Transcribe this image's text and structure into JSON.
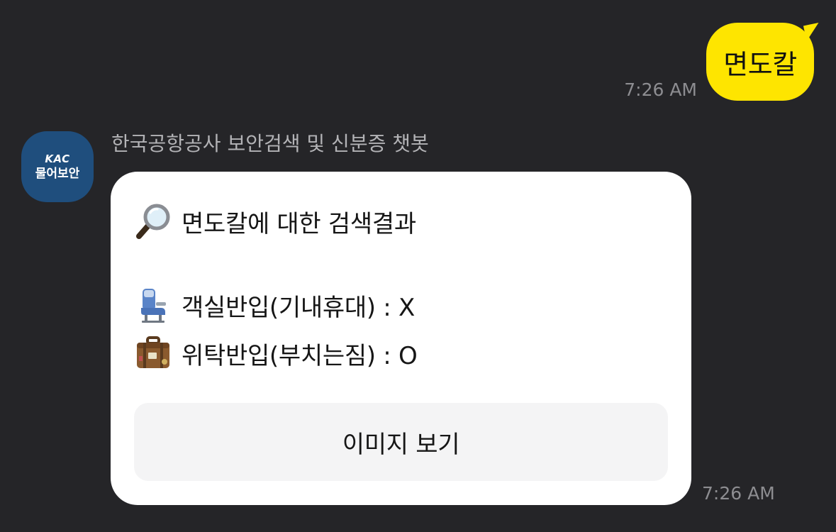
{
  "user_message": {
    "text": "면도칼",
    "time": "7:26 AM"
  },
  "bot": {
    "avatar_logo": "KAC",
    "avatar_label": "물어보안",
    "name": "한국공항공사 보안검색 및 신분증 챗봇",
    "time": "7:26 AM",
    "card": {
      "title_icon": "magnifier-icon",
      "title": "면도칼에 대한 검색결과",
      "cabin_icon": "seat-icon",
      "cabin_text": "객실반입(기내휴대) : X",
      "checked_icon": "suitcase-icon",
      "checked_text": "위탁반입(부치는짐) : O",
      "button_label": "이미지 보기"
    }
  },
  "colors": {
    "background": "#252528",
    "user_bubble": "#fee500",
    "card": "#ffffff",
    "button": "#f4f4f5",
    "timestamp": "#8d8d91",
    "avatar": "#1f4e7d"
  }
}
